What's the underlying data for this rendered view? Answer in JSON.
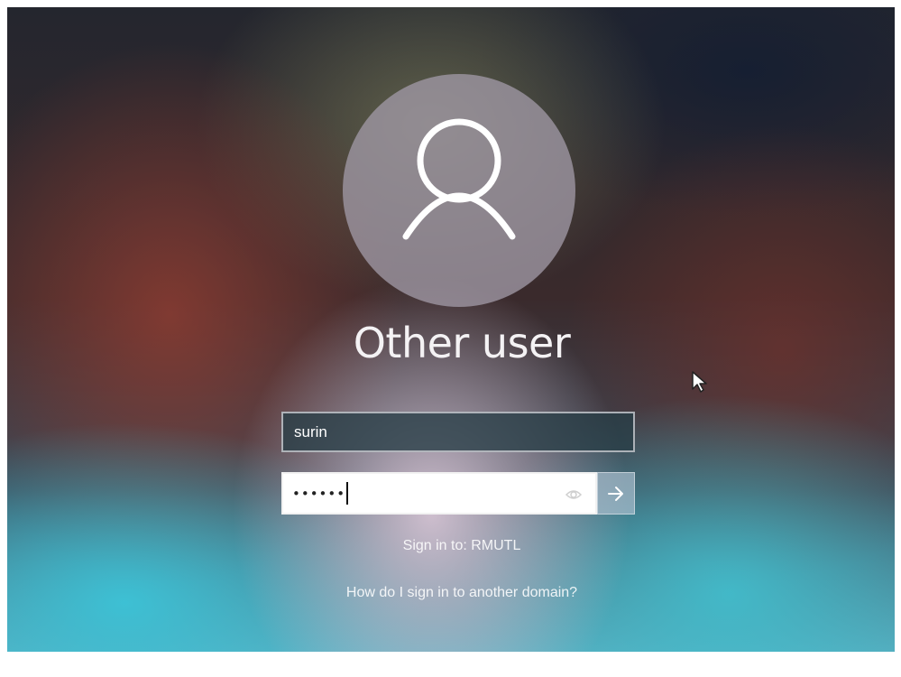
{
  "user": {
    "display_name": "Other user",
    "avatar_icon": "user-silhouette-icon"
  },
  "login": {
    "username_value": "surin",
    "password_mask": "••••••",
    "reveal_icon": "eye-icon",
    "submit_icon": "arrow-right-icon"
  },
  "domain": {
    "sign_in_label": "Sign in to: RMUTL",
    "help_link": "How do I sign in to another domain?"
  },
  "colors": {
    "username_field_bg": "#283e46",
    "text": "#ffffff"
  }
}
